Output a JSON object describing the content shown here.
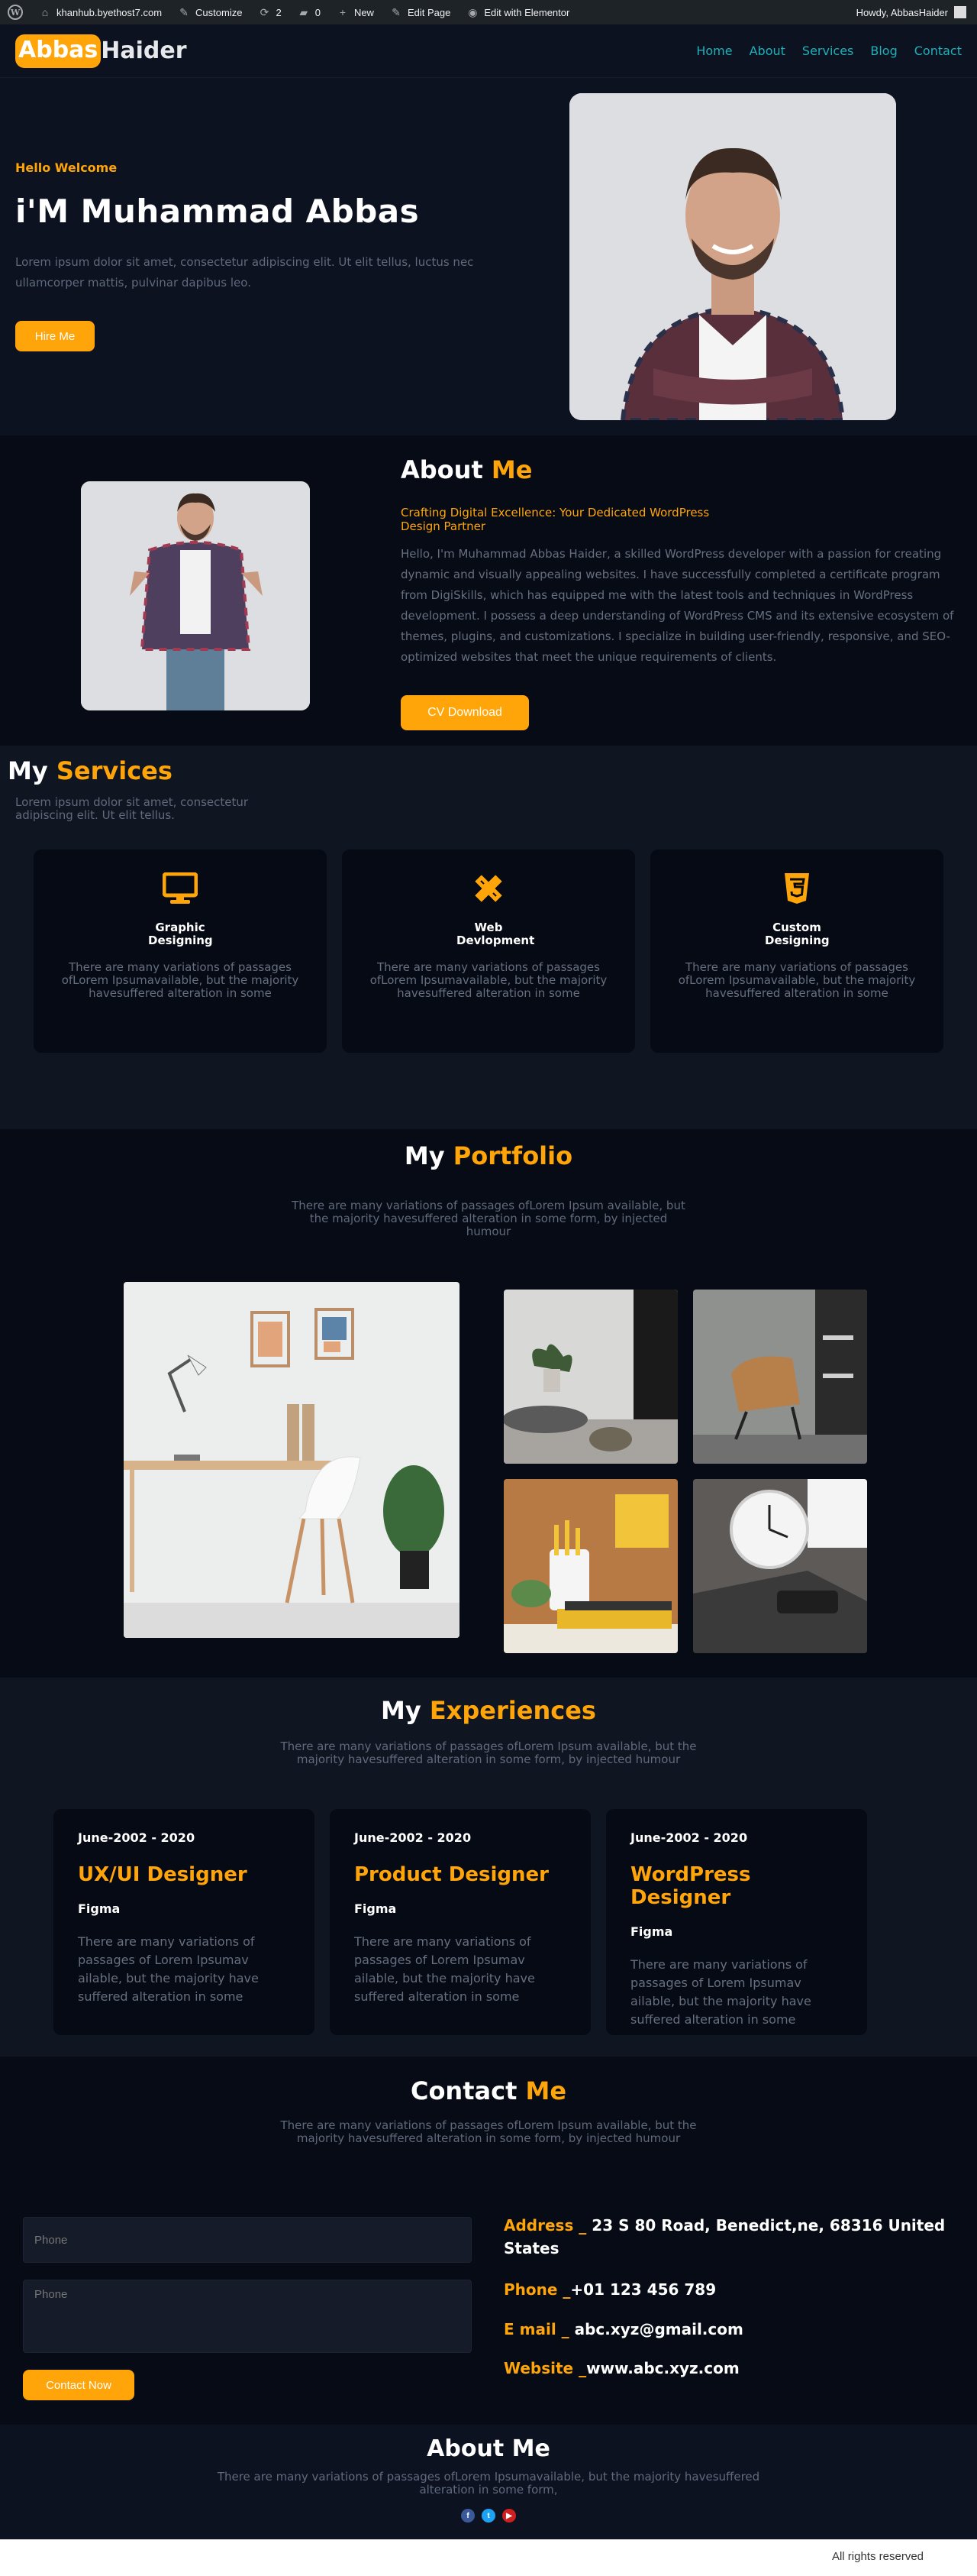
{
  "admin_bar": {
    "site": "khanhub.byethost7.com",
    "customize": "Customize",
    "updates": "2",
    "comments": "0",
    "new": "New",
    "edit_page": "Edit Page",
    "elementor": "Edit with Elementor",
    "howdy": "Howdy, AbbasHaider"
  },
  "header": {
    "logo_highlight": "Abbas",
    "logo_rest": "Haider",
    "nav": [
      "Home",
      "About",
      "Services",
      "Blog",
      "Contact"
    ]
  },
  "hero": {
    "greeting": "Hello Welcome",
    "title": "i'M Muhammad Abbas",
    "lead": "Lorem ipsum dolor sit amet, consectetur adipiscing elit. Ut elit tellus, luctus nec ullamcorper mattis, pulvinar dapibus leo.",
    "button": "Hire Me"
  },
  "about": {
    "title_main": "About",
    "title_accent": "Me",
    "tagline": "Crafting Digital Excellence: Your Dedicated WordPress Design Partner",
    "body": "Hello, I'm Muhammad Abbas Haider, a skilled WordPress developer with a passion for creating dynamic and visually appealing websites. I have successfully completed a certificate program from DigiSkills, which has equipped me with the latest tools and techniques in WordPress development. I possess a deep understanding of WordPress CMS and its extensive ecosystem of themes, plugins, and customizations. I specialize in building user-friendly, responsive, and SEO-optimized websites that meet the unique requirements of clients.",
    "button": "CV Download"
  },
  "services": {
    "title_main": "My",
    "title_accent": "Services",
    "subtitle": "Lorem ipsum dolor sit amet, consectetur adipiscing elit. Ut elit tellus.",
    "items": [
      {
        "icon": "desktop-icon",
        "title": "Graphic Designing",
        "desc": "There are many variations of passages ofLorem Ipsumavailable, but the majority havesuffered alteration in some"
      },
      {
        "icon": "pencil-ruler-icon",
        "title": "Web Devlopment",
        "desc": "There are many variations of passages ofLorem Ipsumavailable, but the majority havesuffered alteration in some"
      },
      {
        "icon": "css3-icon",
        "title": "Custom Designing",
        "desc": "There are many variations of passages ofLorem Ipsumavailable, but the majority havesuffered alteration in some"
      }
    ]
  },
  "portfolio": {
    "title_main": "My",
    "title_accent": "Portfolio",
    "subtitle": "There are many variations of passages ofLorem Ipsum available, but the majority havesuffered alteration in some form, by injected humour"
  },
  "experiences": {
    "title_main": "My",
    "title_accent": "Experiences",
    "subtitle": "There are many variations of passages ofLorem Ipsum available, but the majority havesuffered alteration in some form, by injected humour",
    "items": [
      {
        "date": "June-2002 - 2020",
        "role": "UX/UI Designer",
        "tool": "Figma",
        "desc": "There are many variations of passages of Lorem Ipsumav ailable, but the majority have suffered alteration in some"
      },
      {
        "date": "June-2002 - 2020",
        "role": "Product Designer",
        "tool": "Figma",
        "desc": "There are many variations of passages of Lorem Ipsumav ailable, but the majority have suffered alteration in some"
      },
      {
        "date": "June-2002 - 2020",
        "role": "WordPress Designer",
        "tool": "Figma",
        "desc": "There are many variations of passages of Lorem Ipsumav ailable, but the majority have suffered alteration in some"
      }
    ]
  },
  "contact": {
    "title_main": "Contact",
    "title_accent": "Me",
    "subtitle": "There are many variations of passages ofLorem Ipsum available, but the majority havesuffered alteration in some form, by injected humour",
    "phone_placeholder": "Phone",
    "message_placeholder": "Phone",
    "button": "Contact Now",
    "info": [
      {
        "label": "Address _",
        "value": " 23 S 80 Road, Benedict,ne, 68316 United States"
      },
      {
        "label": "Phone _",
        "value": "+01 123 456 789"
      },
      {
        "label": "E mail _",
        "value": " abc.xyz@gmail.com"
      },
      {
        "label": "Website _",
        "value": "www.abc.xyz.com"
      }
    ]
  },
  "footer": {
    "title": "About Me",
    "text": "There are many variations of passages ofLorem Ipsumavailable, but the majority havesuffered alteration in some form,",
    "social": [
      {
        "icon": "facebook-icon",
        "glyph": "f",
        "color": "#3b5998"
      },
      {
        "icon": "twitter-icon",
        "glyph": "t",
        "color": "#1da1f2"
      },
      {
        "icon": "youtube-icon",
        "glyph": "▶",
        "color": "#cd201f"
      }
    ],
    "copyright": "All rights reserved"
  },
  "colors": {
    "accent": "#ffa50a",
    "nav": "#1fb0b8",
    "bg_dark": "#0c1220",
    "bg_darker": "#070b16"
  }
}
